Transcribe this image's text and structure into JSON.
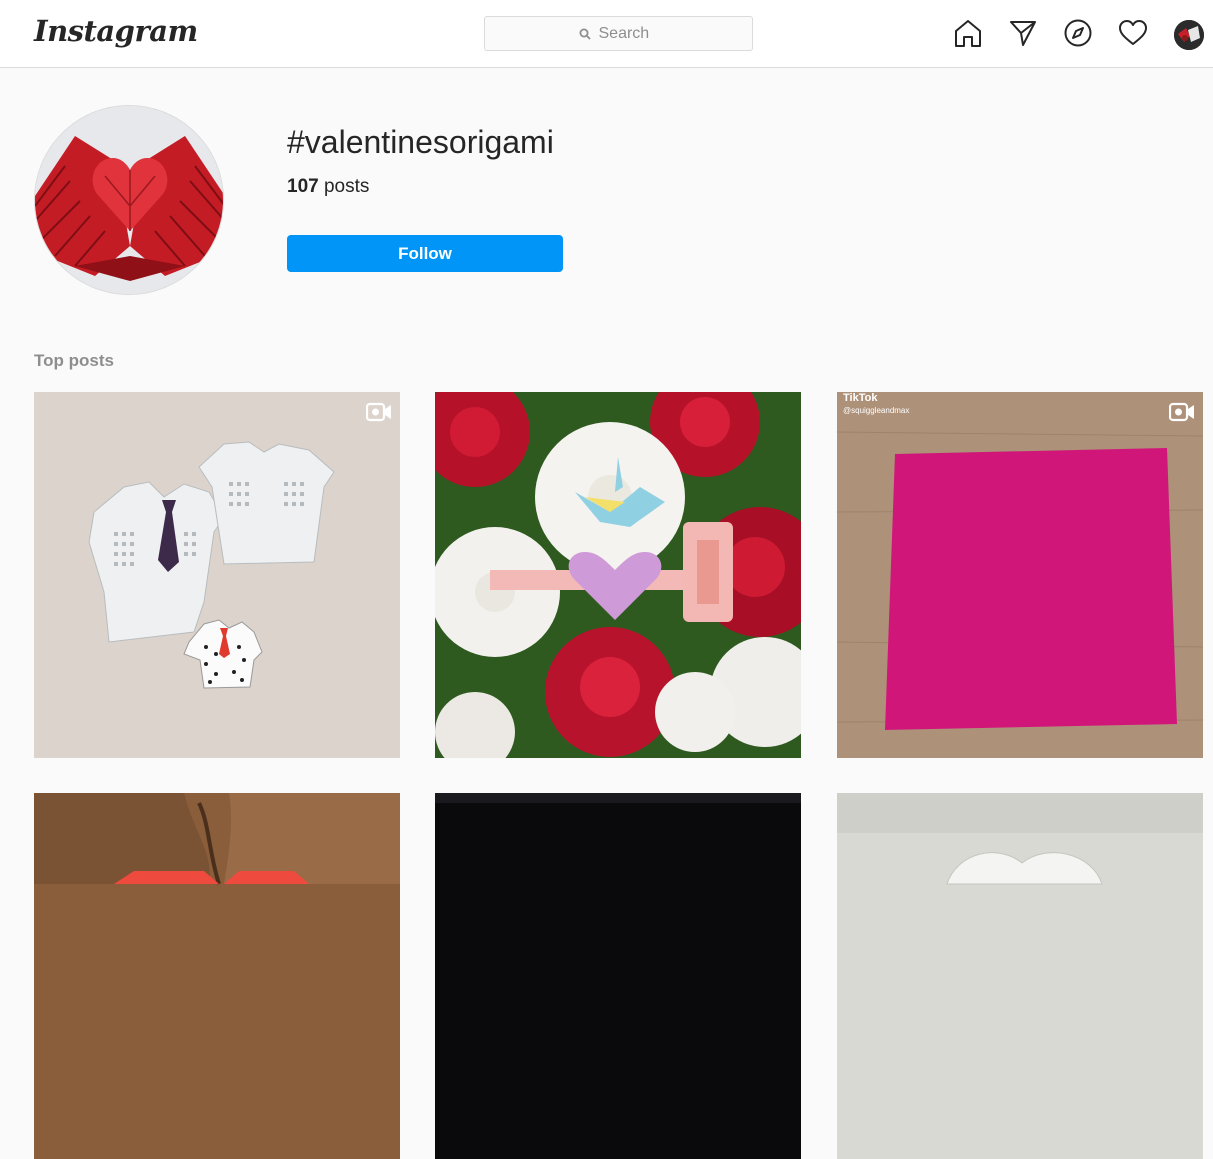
{
  "header": {
    "logo": "Instagram",
    "search_placeholder": "Search"
  },
  "hashtag": {
    "title": "#valentinesorigami",
    "post_count": "107",
    "post_count_label": "posts",
    "follow_label": "Follow"
  },
  "top_posts": {
    "heading": "Top posts",
    "posts": [
      {
        "description": "origami shirts",
        "is_video": true
      },
      {
        "description": "roses with origami crane and heart",
        "is_video": false
      },
      {
        "description": "pink square paper",
        "is_video": true,
        "overlay_brand": "TikTok",
        "overlay_user": "@squiggleandmax"
      },
      {
        "description": "red origami hearts on wood",
        "is_video": false
      },
      {
        "description": "dark background",
        "is_video": false
      },
      {
        "description": "white origami",
        "is_video": false
      }
    ]
  },
  "colors": {
    "accent": "#0095f6",
    "border": "#dbdbdb",
    "background": "#fafafa"
  }
}
